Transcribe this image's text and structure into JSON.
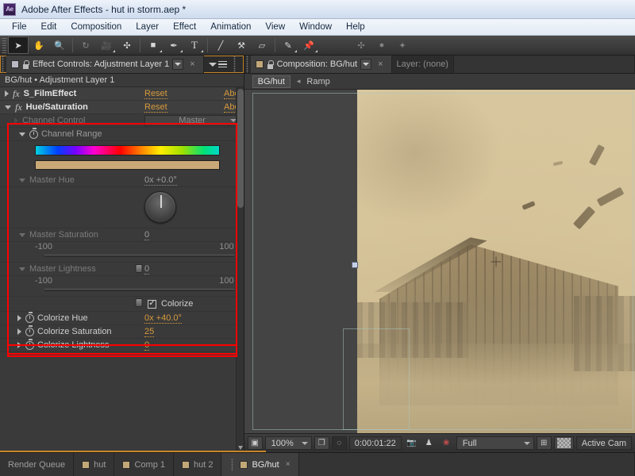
{
  "window": {
    "app_icon": "Ae",
    "title": "Adobe After Effects - hut in storm.aep *"
  },
  "menu": {
    "items": [
      "File",
      "Edit",
      "Composition",
      "Layer",
      "Effect",
      "Animation",
      "View",
      "Window",
      "Help"
    ]
  },
  "toolbar": {
    "tools": [
      {
        "name": "selection-tool",
        "glyph": "➤",
        "active": true
      },
      {
        "name": "hand-tool",
        "glyph": "✋",
        "active": false
      },
      {
        "name": "zoom-tool",
        "glyph": "🔍",
        "active": false
      },
      {
        "name": "rotation-tool",
        "glyph": "↻",
        "active": false
      },
      {
        "name": "camera-tool",
        "glyph": "🎥",
        "active": false
      },
      {
        "name": "pan-behind-tool",
        "glyph": "✣",
        "active": false
      },
      {
        "name": "shape-tool",
        "glyph": "■",
        "active": false
      },
      {
        "name": "pen-tool",
        "glyph": "✒",
        "active": false
      },
      {
        "name": "type-tool",
        "glyph": "T",
        "active": false
      },
      {
        "name": "brush-tool",
        "glyph": "╱",
        "active": false
      },
      {
        "name": "clone-stamp-tool",
        "glyph": "⚒",
        "active": false
      },
      {
        "name": "eraser-tool",
        "glyph": "▱",
        "active": false
      },
      {
        "name": "roto-brush-tool",
        "glyph": "✎",
        "active": false
      },
      {
        "name": "puppet-pin-tool",
        "glyph": "📌",
        "active": false
      }
    ],
    "right_icons": [
      {
        "name": "snapping-icon",
        "glyph": "✣"
      },
      {
        "name": "grid-dot-icon",
        "glyph": "●"
      },
      {
        "name": "mask-icon",
        "glyph": "✦"
      }
    ]
  },
  "effect_controls": {
    "tab_label": "Effect Controls: Adjustment Layer 1",
    "close_glyph": "×",
    "breadcrumb": "BG/hut • Adjustment Layer 1",
    "effects": [
      {
        "name": "S_FilmEffect",
        "reset": "Reset",
        "about": "Abou",
        "expanded": false
      },
      {
        "name": "Hue/Saturation",
        "reset": "Reset",
        "about": "Abou",
        "expanded": true
      }
    ],
    "channel_control": {
      "label": "Channel Control",
      "value": "Master"
    },
    "channel_range": {
      "label": "Channel Range"
    },
    "master_hue": {
      "label": "Master Hue",
      "value": "0x +0.0°"
    },
    "master_saturation": {
      "label": "Master Saturation",
      "value": "0",
      "min": "-100",
      "max": "100",
      "knob_pct": 50
    },
    "master_lightness": {
      "label": "Master Lightness",
      "value": "0",
      "min": "-100",
      "max": "100",
      "knob_pct": 50
    },
    "colorize": {
      "label": "Colorize",
      "checked": true,
      "check_glyph": "✓"
    },
    "colorize_hue": {
      "label": "Colorize Hue",
      "value": "0x +40.0°"
    },
    "colorize_saturation": {
      "label": "Colorize Saturation",
      "value": "25"
    },
    "colorize_lightness": {
      "label": "Colorize Lightness",
      "value": "0"
    },
    "accent_orange": "#d79a3c",
    "highlight_red": "#ff0000"
  },
  "composition_panel": {
    "tab_label": "Composition: BG/hut",
    "layer_tab_label": "Layer: (none)",
    "close_glyph": "×",
    "breadcrumb_comp": "BG/hut",
    "breadcrumb_arrow": "◂",
    "breadcrumb_item": "Ramp",
    "bottom_bar": {
      "zoom": "100%",
      "timecode": "0:00:01:22",
      "resolution": "Full",
      "camera": "Active Cam",
      "snapshot_icon": "📷",
      "show_snapshot_icon": "♟",
      "channels_icon": "❀",
      "region_icon": "❐",
      "grid_icon": "⊞",
      "transparency_icon": "checker"
    }
  },
  "bottom_tabs": [
    {
      "label": "Render Queue",
      "active": false,
      "swatch": false
    },
    {
      "label": "hut",
      "active": false,
      "swatch": true
    },
    {
      "label": "Comp 1",
      "active": false,
      "swatch": true
    },
    {
      "label": "hut 2",
      "active": false,
      "swatch": true
    },
    {
      "label": "BG/hut",
      "active": true,
      "swatch": true,
      "close_glyph": "×"
    }
  ]
}
